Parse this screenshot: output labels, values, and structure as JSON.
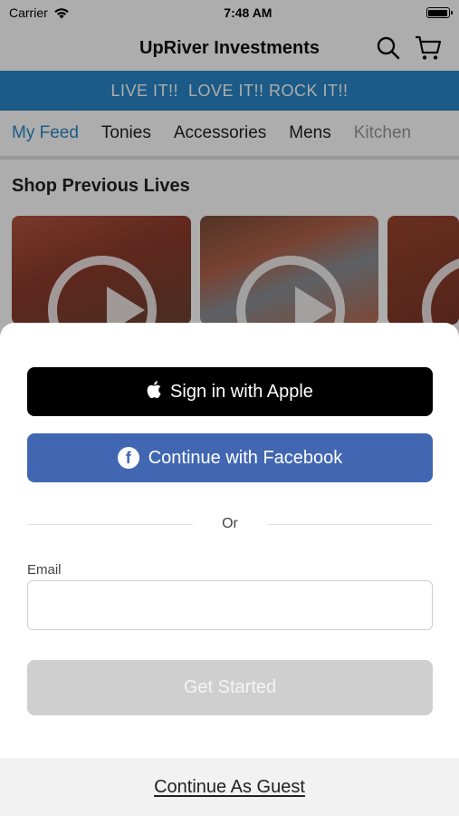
{
  "status_bar": {
    "carrier": "Carrier",
    "time": "7:48 AM"
  },
  "nav": {
    "title": "UpRiver Investments",
    "icons": [
      "search-icon",
      "cart-icon"
    ]
  },
  "banner": {
    "text": "LIVE IT!!  LOVE IT!! ROCK IT!!"
  },
  "tabs": [
    {
      "label": "My Feed",
      "active": true
    },
    {
      "label": "Tonies"
    },
    {
      "label": "Accessories"
    },
    {
      "label": "Mens"
    },
    {
      "label": "Kitchen"
    }
  ],
  "section": {
    "title": "Shop Previous Lives"
  },
  "sheet": {
    "apple_label": "Sign in with Apple",
    "facebook_label": "Continue with Facebook",
    "or_text": "Or",
    "email_label": "Email",
    "email_value": "",
    "email_placeholder": "",
    "get_started_label": "Get Started",
    "guest_label": "Continue As Guest"
  },
  "colors": {
    "accent_blue": "#2a86c8",
    "facebook_blue": "#4267b2",
    "apple_black": "#000000",
    "disabled_gray": "#cfcfcf"
  }
}
